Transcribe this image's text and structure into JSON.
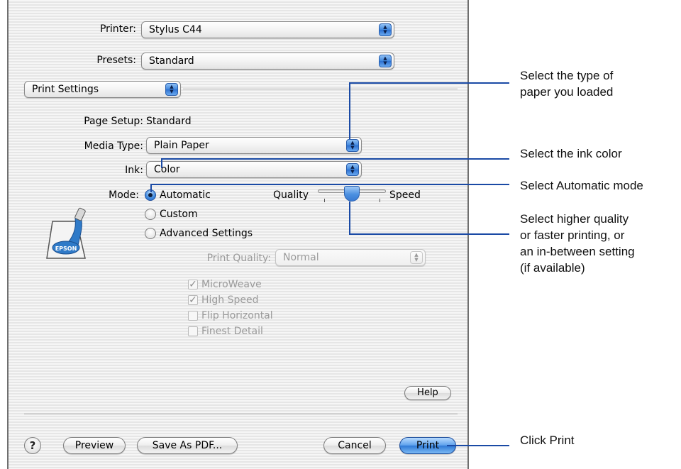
{
  "printer": {
    "label": "Printer:",
    "value": "Stylus C44"
  },
  "presets": {
    "label": "Presets:",
    "value": "Standard"
  },
  "panel": {
    "value": "Print Settings"
  },
  "page_setup": {
    "label": "Page Setup:",
    "value": "Standard"
  },
  "media_type": {
    "label": "Media Type:",
    "value": "Plain Paper"
  },
  "ink": {
    "label": "Ink:",
    "value": "Color"
  },
  "mode": {
    "label": "Mode:",
    "options": [
      "Automatic",
      "Custom",
      "Advanced Settings"
    ],
    "selected": "Automatic"
  },
  "slider": {
    "left_label": "Quality",
    "right_label": "Speed"
  },
  "print_quality": {
    "label": "Print Quality:",
    "value": "Normal"
  },
  "checkboxes": [
    {
      "label": "MicroWeave",
      "checked": true
    },
    {
      "label": "High Speed",
      "checked": true
    },
    {
      "label": "Flip Horizontal",
      "checked": false
    },
    {
      "label": "Finest Detail",
      "checked": false
    }
  ],
  "icon": {
    "text": "EPSON"
  },
  "buttons": {
    "help": "Help",
    "help_circle": "?",
    "preview": "Preview",
    "save_pdf": "Save As PDF...",
    "cancel": "Cancel",
    "print": "Print"
  },
  "callouts": {
    "paper": [
      "Select the type of",
      "paper you loaded"
    ],
    "ink": "Select the ink color",
    "mode": "Select Automatic mode",
    "slider": [
      "Select higher quality",
      "or faster printing, or",
      "an in-between setting",
      "(if available)"
    ],
    "print": "Click Print"
  },
  "colors": {
    "accent": "#3f86dc",
    "callout_line": "#1a4aa5"
  }
}
